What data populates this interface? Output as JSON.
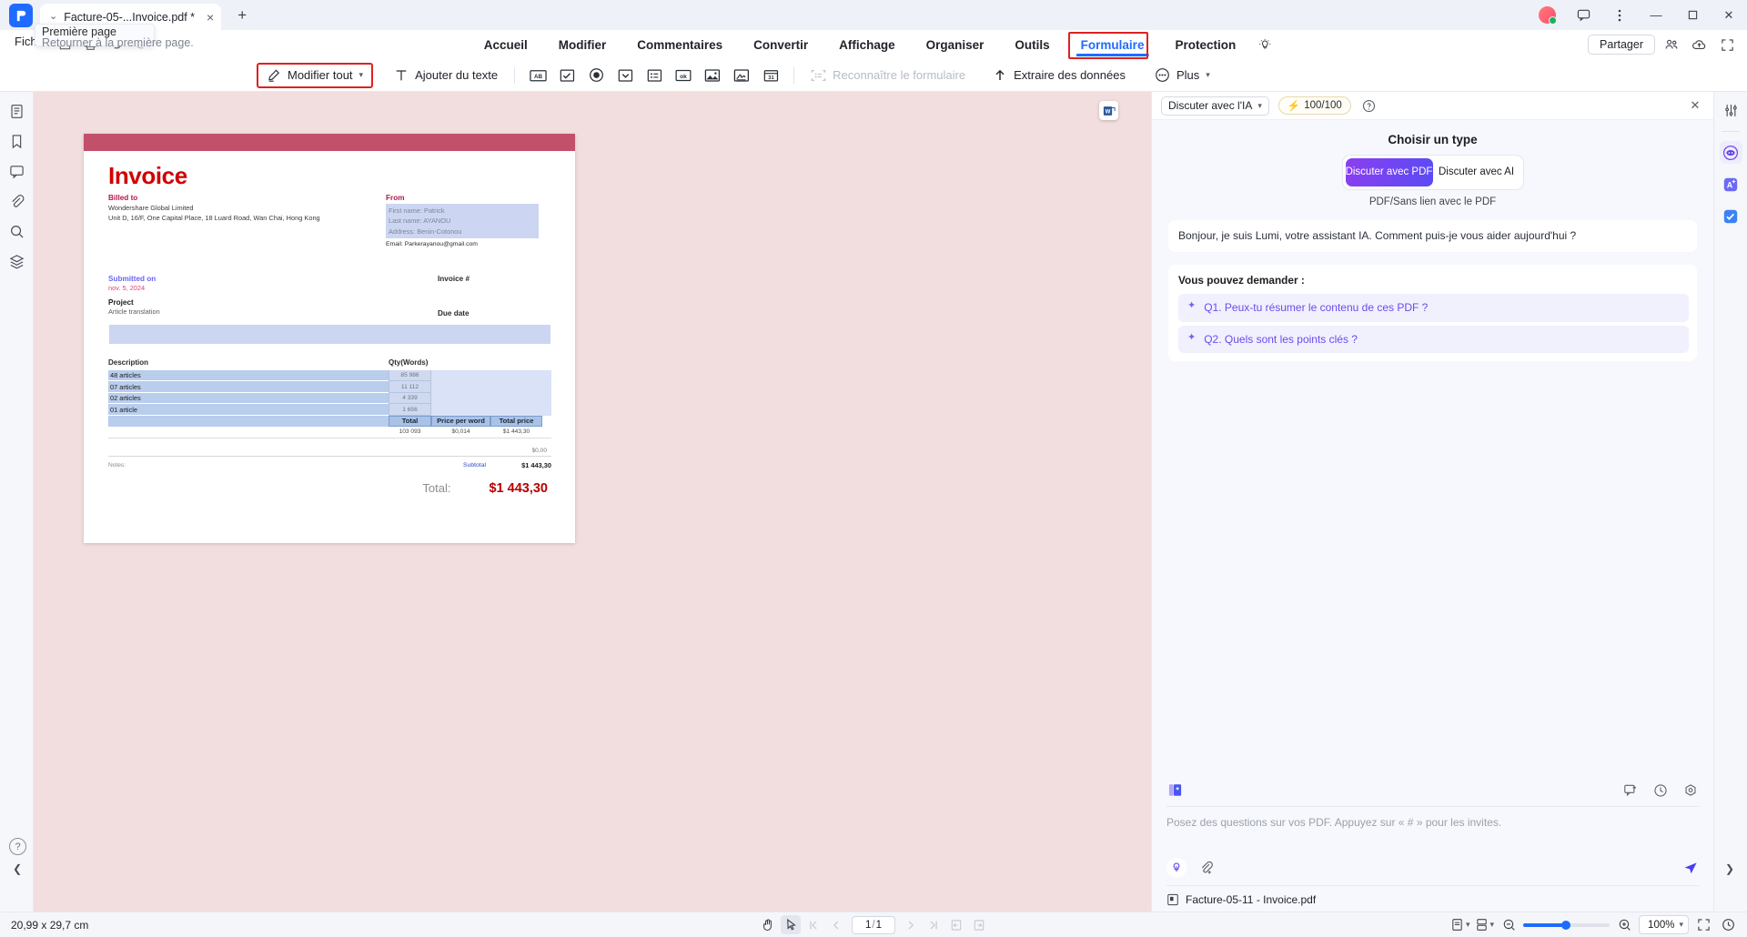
{
  "titlebar": {
    "tab_title": "Facture-05-...Invoice.pdf *",
    "tab_close": "×",
    "new_tab": "+",
    "minimize": "—",
    "maximize": "❐",
    "close": "✕",
    "chevron": "⌄"
  },
  "menubar": {
    "file": "Fichier",
    "items": [
      {
        "label": "Accueil",
        "active": false
      },
      {
        "label": "Modifier",
        "active": false
      },
      {
        "label": "Commentaires",
        "active": false
      },
      {
        "label": "Convertir",
        "active": false
      },
      {
        "label": "Affichage",
        "active": false
      },
      {
        "label": "Organiser",
        "active": false
      },
      {
        "label": "Outils",
        "active": false
      },
      {
        "label": "Formulaire",
        "active": true
      },
      {
        "label": "Protection",
        "active": false
      }
    ],
    "share": "Partager"
  },
  "tooltip": {
    "title": "Première page",
    "body": "Retourner à la première page."
  },
  "toolbar": {
    "edit_all": "Modifier tout",
    "add_text": "Ajouter du texte",
    "recognize_form": "Reconnaître le formulaire",
    "extract_data": "Extraire des données",
    "more": "Plus",
    "field_icons": [
      "text-field-icon",
      "checkbox-icon",
      "radio-button-icon",
      "dropdown-icon",
      "list-box-icon",
      "push-button-icon",
      "image-field-icon",
      "signature-field-icon",
      "date-field-icon"
    ]
  },
  "document": {
    "title": "Invoice",
    "billed_to_label": "Billed to",
    "billed_to_name": "Wondershare Global Limited",
    "billed_to_address": "Unit D, 16/F, One Capital Place, 18 Luard Road, Wan Chai, Hong Kong",
    "from_label": "From",
    "from_first": "First name: Patrick",
    "from_last": "Last name: AYANOU",
    "from_address": "Address: Benin-Cotonou",
    "from_email": "Email: Parkerayanou@gmail.com",
    "submitted_label": "Submitted on",
    "submitted_date": "nov. 5, 2024",
    "project_label": "Project",
    "project_value": "Article translation",
    "invoice_hash_label": "Invoice #",
    "due_date_label": "Due date",
    "col_description": "Description",
    "col_qty": "Qty(Words)",
    "rows": [
      {
        "description": "48 articles",
        "qty": "85 986"
      },
      {
        "description": "07 articles",
        "qty": "11 112"
      },
      {
        "description": "02 articles",
        "qty": "4 339"
      },
      {
        "description": "01 article",
        "qty": "1 656"
      }
    ],
    "total_header": "Total",
    "price_header": "Price per word",
    "total_price_header": "Total price",
    "total_words": "103 093",
    "price_per_word": "$0,014",
    "total_price": "$1 443,30",
    "zero_amount": "$0,00",
    "notes_label": "Notes:",
    "subtotal_label": "Subtotal",
    "subtotal_value": "$1 443,30",
    "grand_label": "Total:",
    "grand_value": "$1 443,30"
  },
  "ai": {
    "mode_select": "Discuter avec l'IA",
    "credits": "100/100",
    "choose_title": "Choisir un type",
    "seg_pdf": "Discuter avec PDF",
    "seg_ai": "Discuter avec AI",
    "seg_note": "PDF/Sans lien avec le PDF",
    "greeting": "Bonjour, je suis Lumi, votre assistant IA. Comment puis-je vous aider aujourd'hui ?",
    "ask_title": "Vous pouvez demander :",
    "questions": [
      "Q1. Peux-tu résumer le contenu de ces PDF ?",
      "Q2. Quels sont les points clés ?"
    ],
    "placeholder": "Posez des questions sur vos PDF. Appuyez sur « # » pour les invites.",
    "file_chip": "Facture-05-11 - Invoice.pdf"
  },
  "statusbar": {
    "page_size": "20,99 x 29,7 cm",
    "page_current": "1",
    "page_sep": "/",
    "page_total": "1",
    "zoom": "100%"
  }
}
